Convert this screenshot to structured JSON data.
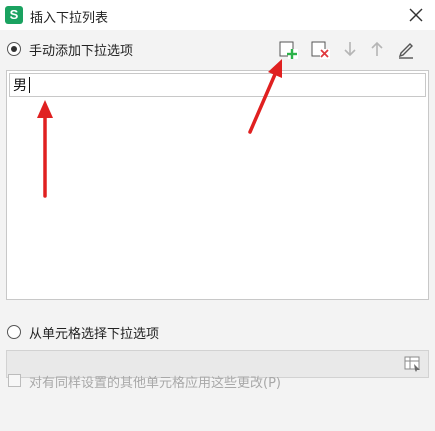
{
  "window": {
    "app_icon_letter": "S",
    "title": "插入下拉列表",
    "close_icon": "close-icon"
  },
  "manual": {
    "label": "手动添加下拉选项",
    "selected": true,
    "toolbar": [
      {
        "name": "add-item-button",
        "icon": "add-item-icon",
        "enabled": true
      },
      {
        "name": "delete-item-button",
        "icon": "delete-item-icon",
        "enabled": true
      },
      {
        "name": "move-down-button",
        "icon": "arrow-down-icon",
        "enabled": false
      },
      {
        "name": "move-up-button",
        "icon": "arrow-up-icon",
        "enabled": false
      },
      {
        "name": "edit-item-button",
        "icon": "pencil-icon",
        "enabled": true
      }
    ],
    "items": [
      {
        "value": "男"
      }
    ]
  },
  "from_cells": {
    "label": "从单元格选择下拉选项",
    "selected": false,
    "range_value": "",
    "range_picker_icon": "range-picker-icon"
  },
  "apply_same": {
    "label": "对有同样设置的其他单元格应用这些更改(P)",
    "checked": false,
    "enabled": false
  },
  "colors": {
    "accent_green": "#1aa260",
    "add_plus": "#2db34a",
    "delete_x": "#e0393e",
    "annotation_arrow": "#e02020"
  }
}
